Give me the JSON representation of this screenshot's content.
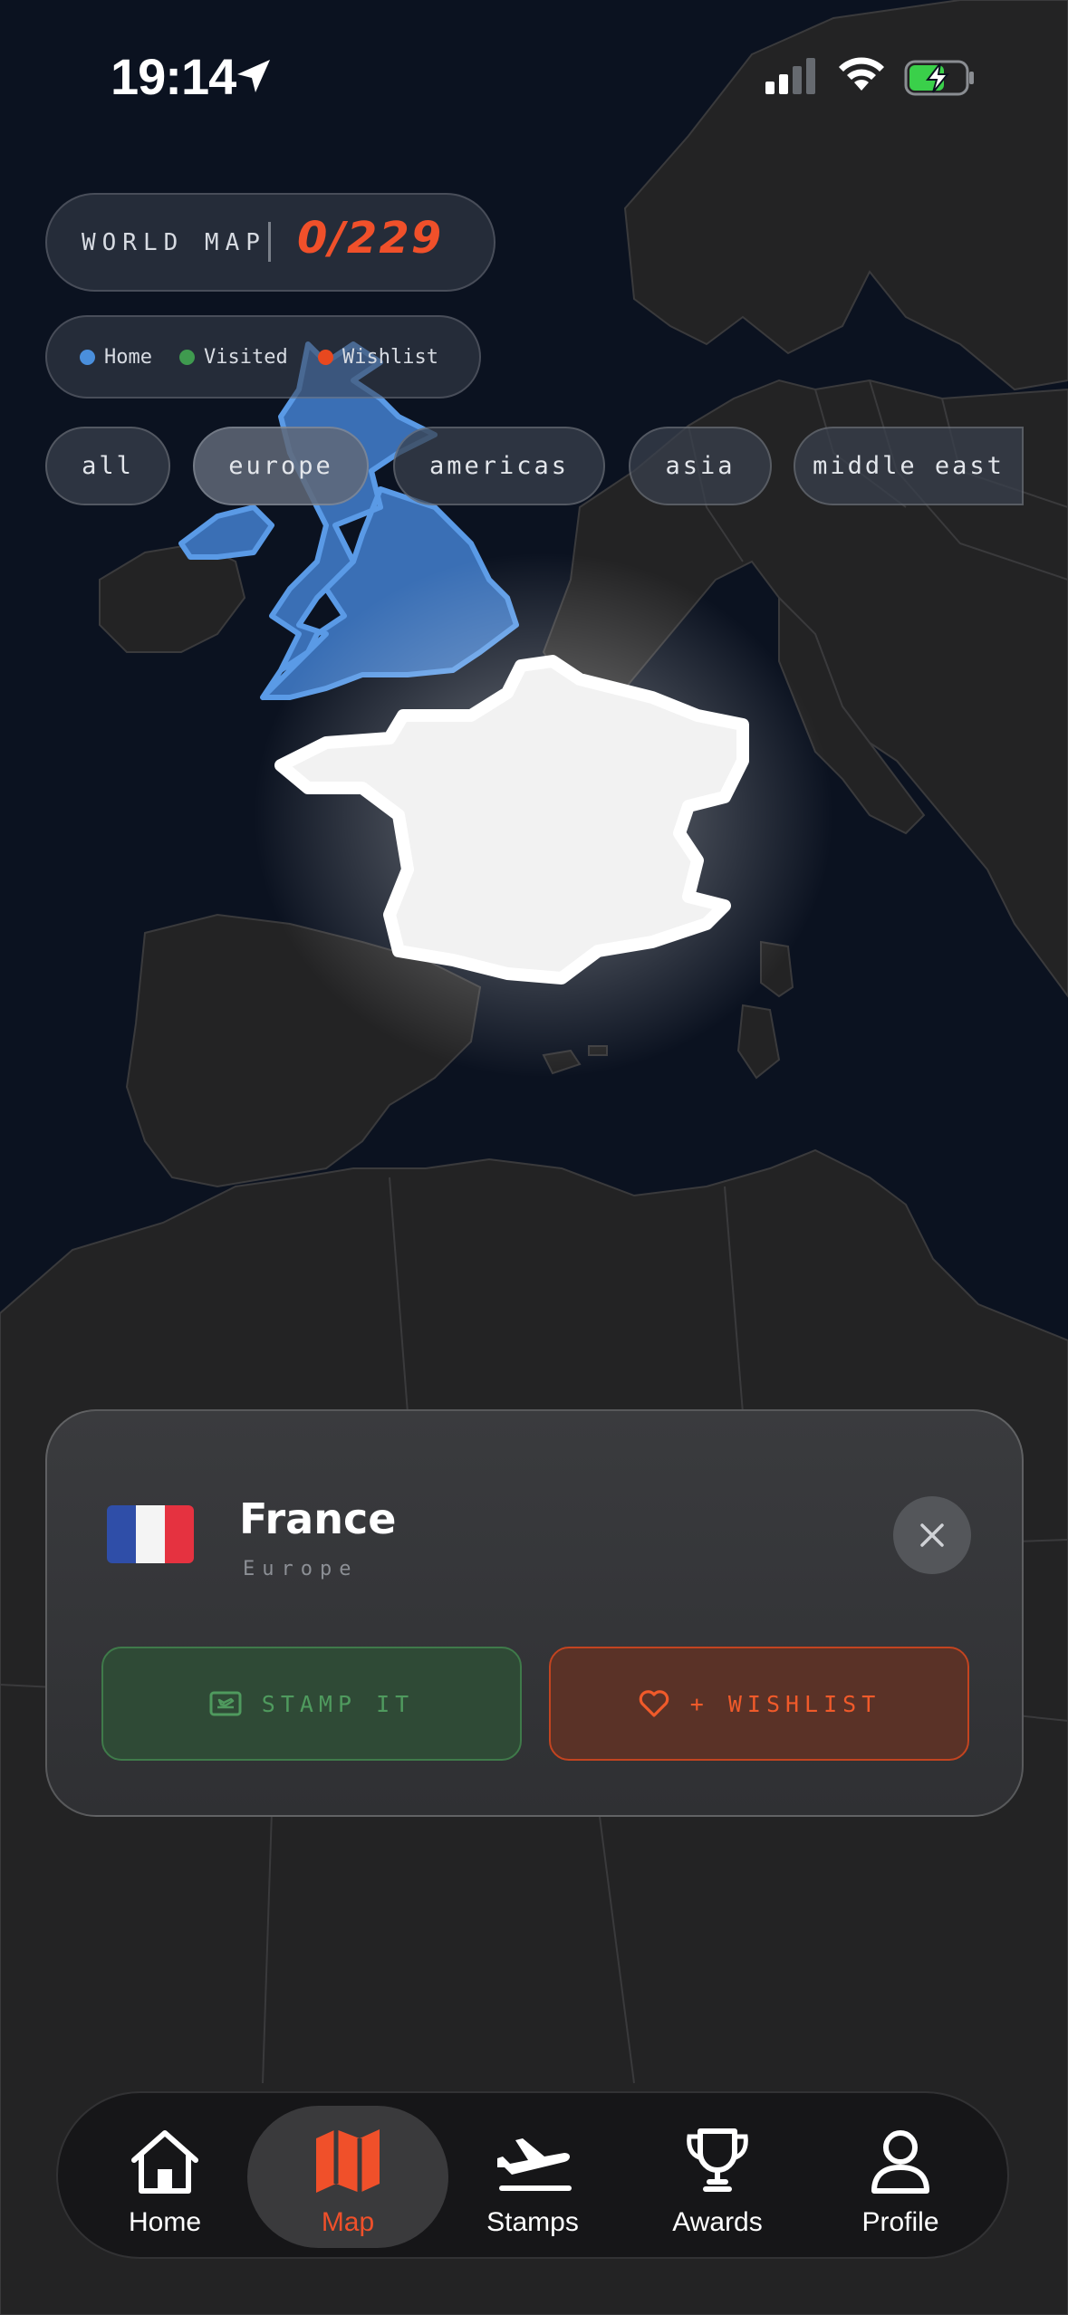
{
  "status_bar": {
    "time": "19:14"
  },
  "header": {
    "title": "WORLD MAP",
    "count": "0/229",
    "accent_color": "#f0502a"
  },
  "legend": [
    {
      "label": "Home",
      "color": "#4a8fdc"
    },
    {
      "label": "Visited",
      "color": "#3f9a4f"
    },
    {
      "label": "Wishlist",
      "color": "#e8481f"
    }
  ],
  "filters": {
    "selected": "europe",
    "items": [
      "all",
      "europe",
      "americas",
      "asia",
      "middle east"
    ]
  },
  "country_card": {
    "name": "France",
    "region": "Europe",
    "flag_icon": "flag-france-icon",
    "stamp_label": "STAMP IT",
    "wishlist_label": "+ WISHLIST"
  },
  "tab_bar": {
    "selected": "Map",
    "items": [
      {
        "label": "Home",
        "icon": "house-icon"
      },
      {
        "label": "Map",
        "icon": "map-icon"
      },
      {
        "label": "Stamps",
        "icon": "airplane-icon"
      },
      {
        "label": "Awards",
        "icon": "trophy-icon"
      },
      {
        "label": "Profile",
        "icon": "person-icon"
      }
    ]
  }
}
